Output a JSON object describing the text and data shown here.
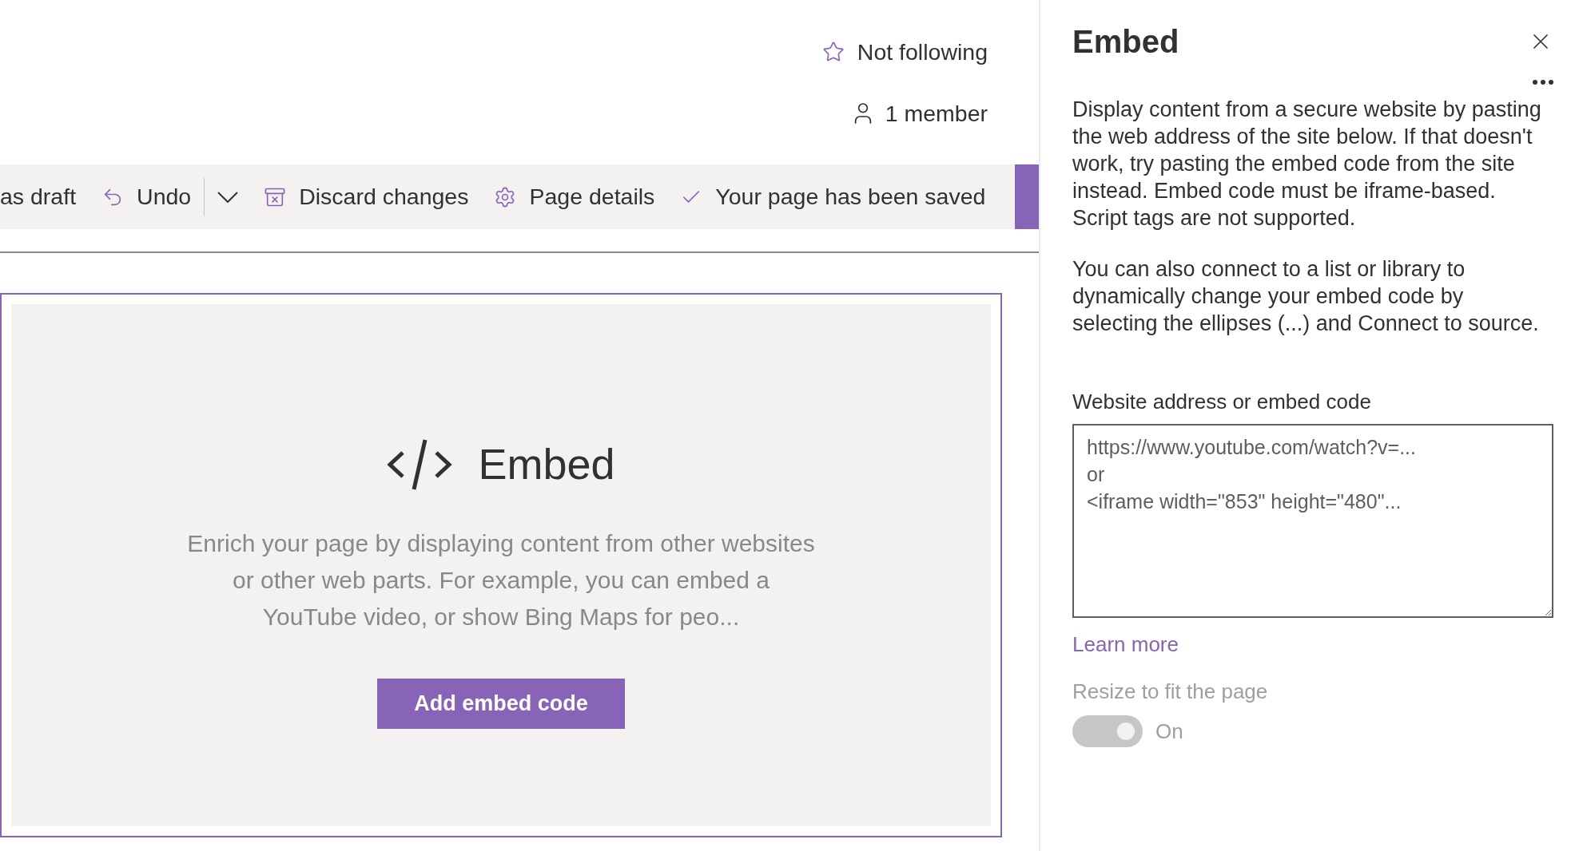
{
  "header": {
    "follow": {
      "label": "Not following",
      "following": false
    },
    "members": "1 member"
  },
  "toolbar": {
    "items": [
      {
        "kind": "text",
        "label": "as draft"
      },
      {
        "kind": "undo",
        "label": "Undo"
      },
      {
        "kind": "dropdown"
      },
      {
        "kind": "discard",
        "label": "Discard changes"
      },
      {
        "kind": "details",
        "label": "Page details"
      },
      {
        "kind": "status",
        "label": "Your page has been saved"
      }
    ]
  },
  "web_part": {
    "title": "Embed",
    "description": "Enrich your page by displaying content from other websites or other web parts. For example, you can embed a YouTube video, or show Bing Maps for peo...",
    "button": "Add embed code"
  },
  "panel": {
    "title": "Embed",
    "paragraphs": [
      "Display content from a secure website by pasting the web address of the site below. If that doesn't work, try pasting the embed code from the site instead. Embed code must be iframe-based. Script tags are not supported.",
      "You can also connect to a list or library to dynamically change your embed code by selecting the ellipses (...) and Connect to source."
    ],
    "field": {
      "label": "Website address or embed code",
      "placeholder": "https://www.youtube.com/watch?v=...\nor\n<iframe width=\"853\" height=\"480\"..."
    },
    "link": "Learn more",
    "toggle": {
      "label": "Resize to fit the page",
      "state": "On",
      "on": true,
      "disabled": true
    }
  }
}
